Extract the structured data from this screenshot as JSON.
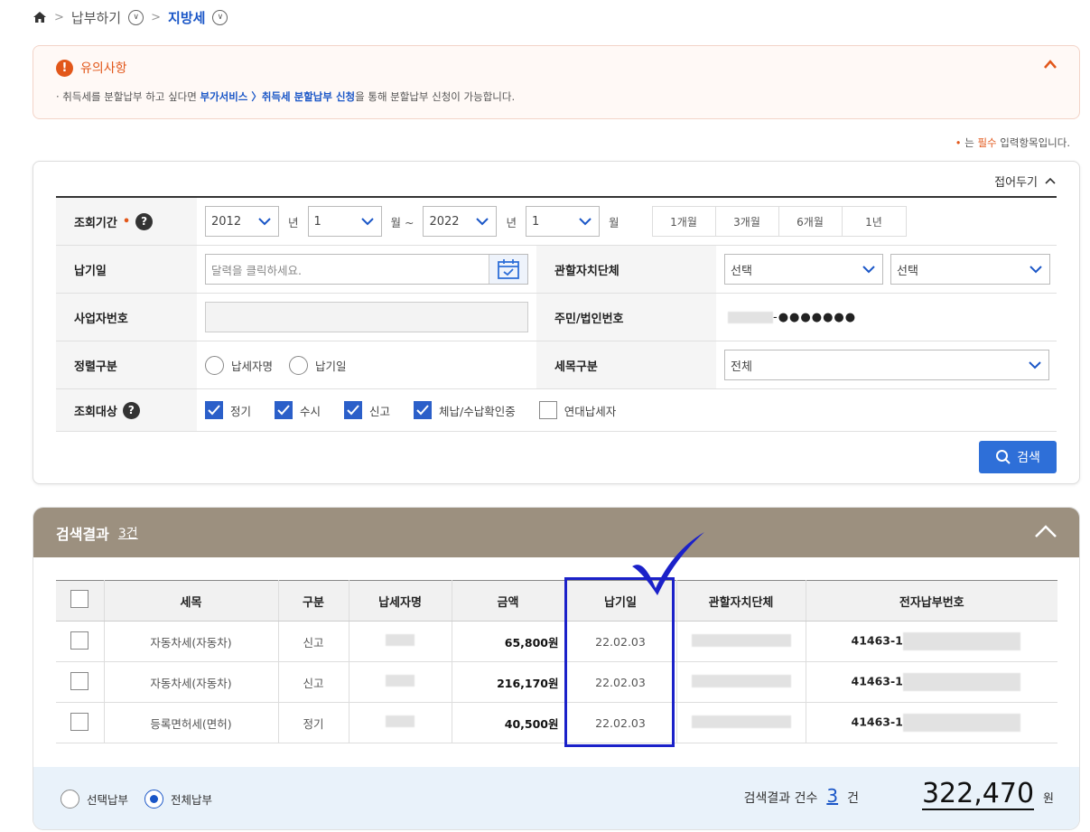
{
  "breadcrumb": {
    "item1": "납부하기",
    "item2": "지방세"
  },
  "notice": {
    "title": "유의사항",
    "text_pre": "· 취득세를 분할납부 하고 싶다면 ",
    "text_link": "부가서비스 〉취득세 분할납부 신청",
    "text_post": "을 통해 분할납부 신청이 가능합니다."
  },
  "required_note": {
    "mark": "•",
    "pre": " 는 ",
    "req": "필수",
    "post": " 입력항목입니다."
  },
  "search_form": {
    "fold_label": "접어두기",
    "period": {
      "label": "조회기간",
      "start_year": "2012",
      "year_unit": "년",
      "start_month": "1",
      "month_unit_range": "월 ~",
      "end_year": "2022",
      "end_month": "1",
      "month_unit": "월",
      "quick_buttons": [
        "1개월",
        "3개월",
        "6개월",
        "1년"
      ]
    },
    "due_date": {
      "label": "납기일",
      "placeholder": "달력을 클릭하세요."
    },
    "jurisdiction": {
      "label": "관할자치단체",
      "select1": "선택",
      "select2": "선택"
    },
    "business_no": {
      "label": "사업자번호"
    },
    "resident_no": {
      "label": "주민/법인번호",
      "masked": "-●●●●●●●"
    },
    "sort": {
      "label": "정렬구분",
      "options": [
        "납세자명",
        "납기일"
      ]
    },
    "tax_item": {
      "label": "세목구분",
      "value": "전체"
    },
    "target": {
      "label": "조회대상",
      "options": [
        {
          "label": "정기",
          "checked": true
        },
        {
          "label": "수시",
          "checked": true
        },
        {
          "label": "신고",
          "checked": true
        },
        {
          "label": "체납/수납확인중",
          "checked": true
        },
        {
          "label": "연대납세자",
          "checked": false
        }
      ]
    },
    "search_button": "검색"
  },
  "results": {
    "title": "검색결과",
    "count_label": "3건",
    "columns": [
      "세목",
      "구분",
      "납세자명",
      "금액",
      "납기일",
      "관할자치단체",
      "전자납부번호"
    ],
    "rows": [
      {
        "tax_item": "자동차세(자동차)",
        "type": "신고",
        "amount": "65,800원",
        "due": "22.02.03",
        "epay": "41463-1"
      },
      {
        "tax_item": "자동차세(자동차)",
        "type": "신고",
        "amount": "216,170원",
        "due": "22.02.03",
        "epay": "41463-1"
      },
      {
        "tax_item": "등록면허세(면허)",
        "type": "정기",
        "amount": "40,500원",
        "due": "22.02.03",
        "epay": "41463-1"
      }
    ],
    "footer": {
      "pay_options": [
        "선택납부",
        "전체납부"
      ],
      "count_label": "검색결과 건수",
      "count": "3",
      "count_unit": "건",
      "total": "322,470",
      "total_unit": "원"
    }
  },
  "colors": {
    "accent": "#1a56c7",
    "warning": "#e2571a",
    "results_header": "#9c907f",
    "annotation": "#1b21c9"
  }
}
